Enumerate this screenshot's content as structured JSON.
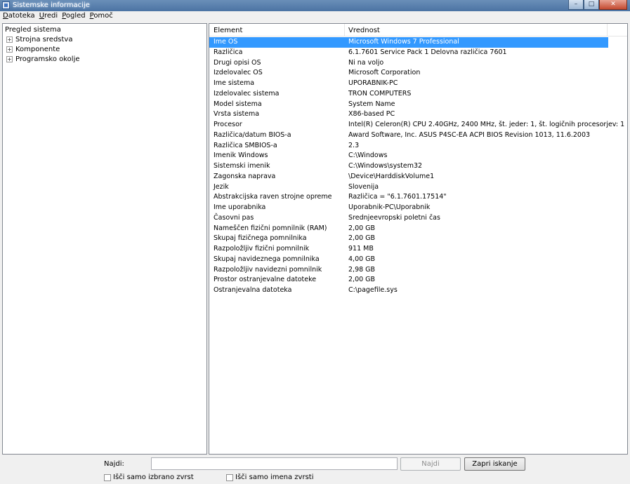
{
  "window": {
    "title": "Sistemske informacije",
    "buttons": {
      "minimize": "–",
      "maximize": "□",
      "close": "✕"
    }
  },
  "menu": [
    "Datoteka",
    "Uredi",
    "Pogled",
    "Pomoč"
  ],
  "tree": {
    "root": "Pregled sistema",
    "items": [
      "Strojna sredstva",
      "Komponente",
      "Programsko okolje"
    ],
    "expander": "+"
  },
  "table": {
    "headers": [
      "Element",
      "Vrednost"
    ],
    "rows": [
      [
        "Ime OS",
        "Microsoft Windows 7 Professional"
      ],
      [
        "Različica",
        "6.1.7601 Service Pack 1 Delovna različica 7601"
      ],
      [
        "Drugi opisi OS",
        "Ni na voljo"
      ],
      [
        "Izdelovalec OS",
        "Microsoft Corporation"
      ],
      [
        "Ime sistema",
        "UPORABNIK-PC"
      ],
      [
        "Izdelovalec sistema",
        "TRON COMPUTERS"
      ],
      [
        "Model sistema",
        "System Name"
      ],
      [
        "Vrsta sistema",
        "X86-based PC"
      ],
      [
        "Procesor",
        "Intel(R) Celeron(R) CPU 2.40GHz, 2400 MHz, št. jeder: 1, št. logičnih procesorjev: 1"
      ],
      [
        "Različica/datum BIOS-a",
        "Award Software, Inc. ASUS P4SC-EA ACPI BIOS Revision 1013, 11.6.2003"
      ],
      [
        "Različica SMBIOS-a",
        "2.3"
      ],
      [
        "Imenik Windows",
        "C:\\Windows"
      ],
      [
        "Sistemski imenik",
        "C:\\Windows\\system32"
      ],
      [
        "Zagonska naprava",
        "\\Device\\HarddiskVolume1"
      ],
      [
        "Jezik",
        "Slovenija"
      ],
      [
        "Abstrakcijska raven strojne opreme",
        "Različica = \"6.1.7601.17514\""
      ],
      [
        "Ime uporabnika",
        "Uporabnik-PC\\Uporabnik"
      ],
      [
        "Časovni pas",
        "Srednjeevropski poletni čas"
      ],
      [
        "Nameščen fizični pomnilnik (RAM)",
        "2,00 GB"
      ],
      [
        "Skupaj fizičnega pomnilnika",
        "2,00 GB"
      ],
      [
        "Razpoložljiv fizični pomnilnik",
        "911 MB"
      ],
      [
        "Skupaj navideznega pomnilnika",
        "4,00 GB"
      ],
      [
        "Razpoložljiv navidezni pomnilnik",
        "2,98 GB"
      ],
      [
        "Prostor ostranjevalne datoteke",
        "2,00 GB"
      ],
      [
        "Ostranjevalna datoteka",
        "C:\\pagefile.sys"
      ]
    ],
    "selected_index": 0
  },
  "find": {
    "label": "Najdi:",
    "value": "",
    "find_button": "Najdi",
    "close_button": "Zapri iskanje",
    "checkbox_selected": "Išči samo izbrano zvrst",
    "checkbox_names": "Išči samo imena zvrsti"
  },
  "colors": {
    "selection": "#3399ff",
    "titlebar": "#4b73a3"
  }
}
